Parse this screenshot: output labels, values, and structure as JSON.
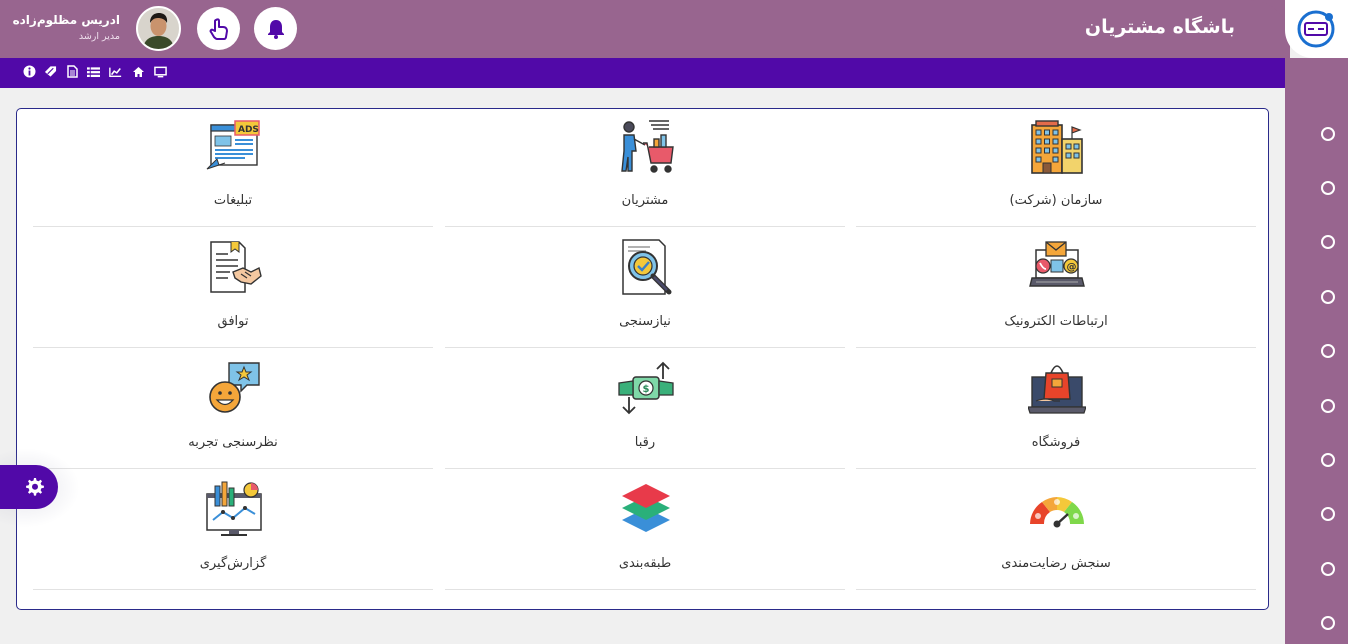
{
  "header": {
    "title": "باشگاه مشتریان",
    "user_name": "ادریس مظلوم‌زاده",
    "user_role": "مدیر ارشد"
  },
  "toolbar": {
    "icons": [
      "monitor-icon",
      "home-icon",
      "chart-line-icon",
      "list-icon",
      "file-icon",
      "tag-icon",
      "info-icon"
    ]
  },
  "tiles": [
    {
      "label": "سازمان (شرکت)",
      "icon": "building-icon"
    },
    {
      "label": "مشتریان",
      "icon": "shopping-cart-icon"
    },
    {
      "label": "تبلیغات",
      "icon": "ads-icon"
    },
    {
      "label": "ارتباطات الکترونیک",
      "icon": "email-laptop-icon"
    },
    {
      "label": "نیازسنجی",
      "icon": "magnifier-check-icon"
    },
    {
      "label": "توافق",
      "icon": "handshake-icon"
    },
    {
      "label": "فروشگاه",
      "icon": "shop-laptop-icon"
    },
    {
      "label": "رقبا",
      "icon": "money-exchange-icon"
    },
    {
      "label": "نظرسنجی تجربه",
      "icon": "smile-star-icon"
    },
    {
      "label": "سنجش رضایت‌مندی",
      "icon": "gauge-icon"
    },
    {
      "label": "طبقه‌بندی",
      "icon": "layers-icon"
    },
    {
      "label": "گزارش‌گیری",
      "icon": "report-monitor-icon"
    }
  ],
  "colors": {
    "header": "#98658f",
    "toolbar": "#5109a8",
    "sidebar": "#98658f"
  }
}
